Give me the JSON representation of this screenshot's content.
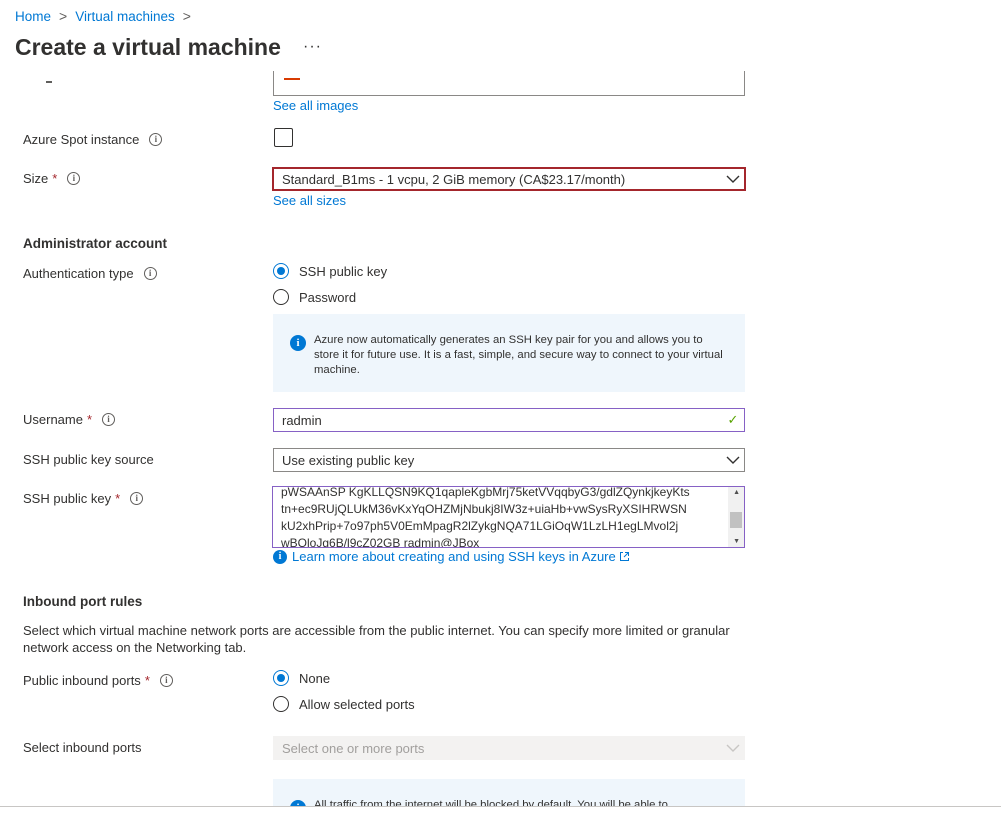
{
  "breadcrumb": {
    "home": "Home",
    "sep1": ">",
    "vms": "Virtual machines",
    "sep2": ">"
  },
  "title": "Create a virtual machine",
  "title_more": "···",
  "image": {
    "see_all_link": "See all images"
  },
  "spot": {
    "label": "Azure Spot instance",
    "checked": false
  },
  "size": {
    "label": "Size",
    "required": "*",
    "value": "Standard_B1ms - 1 vcpu, 2 GiB memory (CA$23.17/month)",
    "see_all_link": "See all sizes"
  },
  "admin": {
    "heading": "Administrator account",
    "auth_label": "Authentication type",
    "auth_options": [
      "SSH public key",
      "Password"
    ],
    "auth_selected": "SSH public key",
    "info_text": "Azure now automatically generates an SSH key pair for you and allows you to store it for future use. It is a fast, simple, and secure way to connect to your virtual machine.",
    "username_label": "Username",
    "username_value": "radmin",
    "keysource_label": "SSH public key source",
    "keysource_value": "Use existing public key",
    "key_label": "SSH public key",
    "key_lines": [
      "pWSAAnSP KgKLLQSN9KQ1qapleKgbMrj75ketVVqqbyG3/gdlZQynkjkeyKts",
      "tn+ec9RUjQLUkM36vKxYqOHZMjNbukj8IW3z+uiaHb+vwSysRyXSIHRWSN",
      "kU2xhPrip+7o97ph5V0EmMpagR2lZykgNQA71LGiOqW1LzLH1egLMvol2j",
      "wBQloJg6B/l9cZ02GB radmin@JBox"
    ],
    "learn_more_link": "Learn more about creating and using SSH keys in Azure"
  },
  "inbound": {
    "heading": "Inbound port rules",
    "description": "Select which virtual machine network ports are accessible from the public internet. You can specify more limited or granular network access on the Networking tab.",
    "public_label": "Public inbound ports",
    "public_options": [
      "None",
      "Allow selected ports"
    ],
    "public_selected": "None",
    "select_label": "Select inbound ports",
    "select_placeholder": "Select one or more ports",
    "info_text": "All traffic from the internet will be blocked by default. You will be able to"
  },
  "icons": {
    "check": "✓",
    "info": "i",
    "chevron": "chevron-down-icon",
    "external": "external-link-icon"
  },
  "colors": {
    "accent": "#0078d4",
    "error": "#a4262c",
    "valid_border": "#8661c5",
    "success": "#57a300",
    "info_bg": "#eff6fc"
  }
}
